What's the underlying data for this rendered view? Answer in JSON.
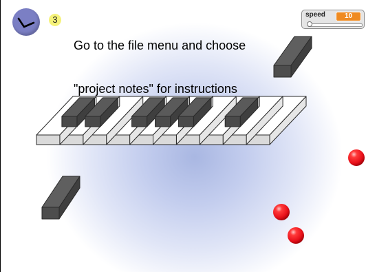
{
  "stage": {
    "background_center_color": "#a9b7e2",
    "background_edge_color": "#ffffff"
  },
  "clock_sprite": {
    "icon": "clock-hand-icon",
    "color": "#7b7fc4"
  },
  "step_badge": {
    "number": "3",
    "color": "#f5f27a"
  },
  "instruction": {
    "line1": "Go to the file menu and choose",
    "line2": "\"project notes\" for instructions"
  },
  "speed_monitor": {
    "label": "speed",
    "value": "10",
    "value_color": "#ef8a20",
    "slider_level": 0.0
  },
  "piano": {
    "white_key_count": 10,
    "black_key_count": 6,
    "white_color": "#ffffff",
    "black_color": "#5a5a5a"
  },
  "loose_blocks": {
    "count": 2,
    "color": "#5a5a5a"
  },
  "balls": {
    "count": 3,
    "color": "#e8101a"
  }
}
